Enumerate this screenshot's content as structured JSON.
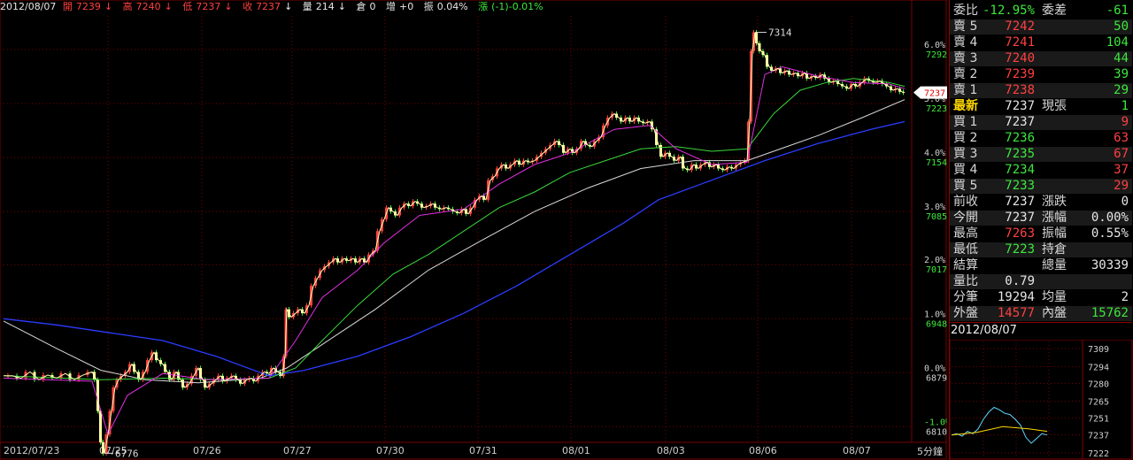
{
  "header": {
    "date": "2012/08/07",
    "open_label": "開",
    "open": "7239",
    "high_label": "高",
    "high": "7240",
    "low_label": "低",
    "low": "7237",
    "close_label": "收",
    "close": "7237",
    "vol_label": "量",
    "vol": "214",
    "oi_label": "倉",
    "oi": "0",
    "chg_label": "增",
    "chg": "+0",
    "amp_label": "振",
    "amp": "0.04%",
    "rise_label": "漲",
    "rise": "(-1)-0.01%",
    "down_arrow": "↓"
  },
  "chart_data": {
    "type": "line",
    "x": [
      "2012/07/23",
      "07/25",
      "07/26",
      "07/27",
      "07/30",
      "07/31",
      "08/01",
      "08/03",
      "08/06",
      "08/07"
    ],
    "interval_label": "5分鐘",
    "ylim": [
      6790,
      7335
    ],
    "ticks_price": [
      "7292",
      "7223",
      "7154",
      "7085",
      "7017",
      "6948",
      "6879",
      "6810"
    ],
    "ticks_pct": [
      "6.0%",
      "5.0%",
      "4.0%",
      "3.0%",
      "2.0%",
      "1.0%",
      "0.0%",
      "-1.0%"
    ],
    "tick_values": [
      7292,
      7223,
      7154,
      7085,
      7017,
      6948,
      6879,
      6810
    ],
    "annot_high": "7314",
    "annot_low": "6776",
    "annot_high_value": 7314,
    "annot_low_value": 6776,
    "last_price": "7237",
    "last_value": 7237,
    "price_path": [
      [
        0,
        6875
      ],
      [
        10,
        6875
      ],
      [
        20,
        6872
      ],
      [
        30,
        6880
      ],
      [
        40,
        6870
      ],
      [
        50,
        6876
      ],
      [
        60,
        6872
      ],
      [
        70,
        6878
      ],
      [
        80,
        6870
      ],
      [
        90,
        6876
      ],
      [
        100,
        6880
      ],
      [
        105,
        6870
      ],
      [
        108,
        6830
      ],
      [
        111,
        6790
      ],
      [
        114,
        6776
      ],
      [
        118,
        6800
      ],
      [
        122,
        6830
      ],
      [
        126,
        6860
      ],
      [
        130,
        6870
      ],
      [
        135,
        6875
      ],
      [
        140,
        6880
      ],
      [
        145,
        6890
      ],
      [
        150,
        6880
      ],
      [
        155,
        6870
      ],
      [
        160,
        6880
      ],
      [
        165,
        6895
      ],
      [
        170,
        6905
      ],
      [
        175,
        6895
      ],
      [
        180,
        6890
      ],
      [
        185,
        6880
      ],
      [
        190,
        6870
      ],
      [
        195,
        6880
      ],
      [
        200,
        6870
      ],
      [
        205,
        6860
      ],
      [
        210,
        6865
      ],
      [
        215,
        6875
      ],
      [
        220,
        6885
      ],
      [
        225,
        6870
      ],
      [
        230,
        6860
      ],
      [
        235,
        6865
      ],
      [
        240,
        6870
      ],
      [
        245,
        6875
      ],
      [
        250,
        6868
      ],
      [
        255,
        6872
      ],
      [
        260,
        6875
      ],
      [
        265,
        6870
      ],
      [
        270,
        6865
      ],
      [
        275,
        6870
      ],
      [
        280,
        6872
      ],
      [
        285,
        6868
      ],
      [
        290,
        6875
      ],
      [
        295,
        6880
      ],
      [
        300,
        6878
      ],
      [
        305,
        6885
      ],
      [
        310,
        6880
      ],
      [
        315,
        6875
      ],
      [
        318,
        6900
      ],
      [
        320,
        6960
      ],
      [
        325,
        6950
      ],
      [
        330,
        6955
      ],
      [
        335,
        6960
      ],
      [
        340,
        6955
      ],
      [
        345,
        6965
      ],
      [
        350,
        6990
      ],
      [
        355,
        7000
      ],
      [
        360,
        7010
      ],
      [
        365,
        7015
      ],
      [
        370,
        7020
      ],
      [
        375,
        7025
      ],
      [
        380,
        7020
      ],
      [
        385,
        7025
      ],
      [
        390,
        7022
      ],
      [
        395,
        7025
      ],
      [
        400,
        7020
      ],
      [
        405,
        7025
      ],
      [
        410,
        7020
      ],
      [
        415,
        7030
      ],
      [
        420,
        7035
      ],
      [
        425,
        7060
      ],
      [
        430,
        7075
      ],
      [
        435,
        7090
      ],
      [
        440,
        7085
      ],
      [
        445,
        7080
      ],
      [
        450,
        7090
      ],
      [
        455,
        7095
      ],
      [
        460,
        7092
      ],
      [
        465,
        7098
      ],
      [
        470,
        7095
      ],
      [
        475,
        7090
      ],
      [
        480,
        7092
      ],
      [
        485,
        7095
      ],
      [
        490,
        7090
      ],
      [
        495,
        7088
      ],
      [
        500,
        7090
      ],
      [
        505,
        7088
      ],
      [
        510,
        7085
      ],
      [
        515,
        7083
      ],
      [
        520,
        7088
      ],
      [
        525,
        7082
      ],
      [
        530,
        7090
      ],
      [
        535,
        7100
      ],
      [
        540,
        7105
      ],
      [
        545,
        7100
      ],
      [
        550,
        7125
      ],
      [
        555,
        7130
      ],
      [
        560,
        7140
      ],
      [
        565,
        7145
      ],
      [
        570,
        7140
      ],
      [
        575,
        7145
      ],
      [
        580,
        7150
      ],
      [
        585,
        7145
      ],
      [
        590,
        7150
      ],
      [
        595,
        7148
      ],
      [
        600,
        7150
      ],
      [
        605,
        7155
      ],
      [
        610,
        7160
      ],
      [
        615,
        7165
      ],
      [
        620,
        7170
      ],
      [
        625,
        7175
      ],
      [
        630,
        7170
      ],
      [
        635,
        7160
      ],
      [
        640,
        7165
      ],
      [
        645,
        7160
      ],
      [
        650,
        7165
      ],
      [
        655,
        7175
      ],
      [
        660,
        7170
      ],
      [
        665,
        7168
      ],
      [
        670,
        7175
      ],
      [
        675,
        7180
      ],
      [
        680,
        7195
      ],
      [
        685,
        7205
      ],
      [
        690,
        7210
      ],
      [
        695,
        7205
      ],
      [
        700,
        7200
      ],
      [
        705,
        7205
      ],
      [
        710,
        7200
      ],
      [
        715,
        7205
      ],
      [
        720,
        7200
      ],
      [
        725,
        7198
      ],
      [
        730,
        7200
      ],
      [
        735,
        7190
      ],
      [
        740,
        7170
      ],
      [
        745,
        7155
      ],
      [
        750,
        7160
      ],
      [
        755,
        7155
      ],
      [
        760,
        7150
      ],
      [
        765,
        7155
      ],
      [
        770,
        7140
      ],
      [
        775,
        7138
      ],
      [
        780,
        7145
      ],
      [
        785,
        7140
      ],
      [
        790,
        7145
      ],
      [
        795,
        7148
      ],
      [
        800,
        7142
      ],
      [
        805,
        7145
      ],
      [
        810,
        7140
      ],
      [
        815,
        7138
      ],
      [
        820,
        7142
      ],
      [
        825,
        7140
      ],
      [
        830,
        7145
      ],
      [
        835,
        7148
      ],
      [
        840,
        7150
      ],
      [
        843,
        7200
      ],
      [
        846,
        7290
      ],
      [
        849,
        7314
      ],
      [
        852,
        7300
      ],
      [
        856,
        7290
      ],
      [
        860,
        7285
      ],
      [
        865,
        7270
      ],
      [
        870,
        7265
      ],
      [
        875,
        7268
      ],
      [
        880,
        7262
      ],
      [
        885,
        7265
      ],
      [
        890,
        7260
      ],
      [
        895,
        7262
      ],
      [
        900,
        7258
      ],
      [
        905,
        7262
      ],
      [
        910,
        7255
      ],
      [
        915,
        7258
      ],
      [
        920,
        7256
      ],
      [
        925,
        7260
      ],
      [
        930,
        7255
      ],
      [
        935,
        7250
      ],
      [
        940,
        7252
      ],
      [
        945,
        7248
      ],
      [
        950,
        7245
      ],
      [
        955,
        7242
      ],
      [
        960,
        7248
      ],
      [
        965,
        7245
      ],
      [
        970,
        7250
      ],
      [
        975,
        7255
      ],
      [
        980,
        7252
      ],
      [
        985,
        7250
      ],
      [
        990,
        7252
      ],
      [
        995,
        7248
      ],
      [
        1000,
        7245
      ],
      [
        1005,
        7240
      ],
      [
        1010,
        7242
      ],
      [
        1015,
        7238
      ],
      [
        1018,
        7237
      ]
    ],
    "ma_white": [
      [
        0,
        6945
      ],
      [
        60,
        6910
      ],
      [
        110,
        6882
      ],
      [
        160,
        6870
      ],
      [
        220,
        6866
      ],
      [
        290,
        6872
      ],
      [
        320,
        6885
      ],
      [
        360,
        6915
      ],
      [
        420,
        6960
      ],
      [
        480,
        7010
      ],
      [
        540,
        7048
      ],
      [
        600,
        7085
      ],
      [
        660,
        7115
      ],
      [
        720,
        7140
      ],
      [
        780,
        7150
      ],
      [
        840,
        7150
      ],
      [
        870,
        7162
      ],
      [
        920,
        7182
      ],
      [
        970,
        7205
      ],
      [
        1018,
        7228
      ]
    ],
    "ma_blue": [
      [
        0,
        6948
      ],
      [
        60,
        6940
      ],
      [
        120,
        6930
      ],
      [
        180,
        6920
      ],
      [
        240,
        6900
      ],
      [
        300,
        6875
      ],
      [
        340,
        6882
      ],
      [
        400,
        6900
      ],
      [
        460,
        6925
      ],
      [
        520,
        6955
      ],
      [
        580,
        6990
      ],
      [
        640,
        7030
      ],
      [
        700,
        7070
      ],
      [
        740,
        7100
      ],
      [
        800,
        7125
      ],
      [
        860,
        7150
      ],
      [
        920,
        7172
      ],
      [
        980,
        7190
      ],
      [
        1018,
        7200
      ]
    ],
    "ma_green": [
      [
        0,
        6875
      ],
      [
        110,
        6870
      ],
      [
        180,
        6872
      ],
      [
        250,
        6870
      ],
      [
        300,
        6872
      ],
      [
        330,
        6885
      ],
      [
        360,
        6920
      ],
      [
        400,
        6965
      ],
      [
        440,
        7005
      ],
      [
        480,
        7030
      ],
      [
        520,
        7060
      ],
      [
        560,
        7090
      ],
      [
        600,
        7110
      ],
      [
        640,
        7135
      ],
      [
        680,
        7150
      ],
      [
        720,
        7165
      ],
      [
        760,
        7168
      ],
      [
        800,
        7162
      ],
      [
        840,
        7165
      ],
      [
        870,
        7210
      ],
      [
        900,
        7240
      ],
      [
        930,
        7250
      ],
      [
        960,
        7255
      ],
      [
        1000,
        7250
      ],
      [
        1018,
        7245
      ]
    ],
    "ma_magenta": [
      [
        0,
        6872
      ],
      [
        100,
        6868
      ],
      [
        118,
        6800
      ],
      [
        140,
        6850
      ],
      [
        180,
        6878
      ],
      [
        230,
        6870
      ],
      [
        300,
        6872
      ],
      [
        330,
        6920
      ],
      [
        360,
        6975
      ],
      [
        400,
        7010
      ],
      [
        430,
        7045
      ],
      [
        470,
        7080
      ],
      [
        520,
        7088
      ],
      [
        560,
        7120
      ],
      [
        600,
        7145
      ],
      [
        640,
        7160
      ],
      [
        690,
        7190
      ],
      [
        730,
        7195
      ],
      [
        760,
        7165
      ],
      [
        800,
        7145
      ],
      [
        840,
        7148
      ],
      [
        860,
        7260
      ],
      [
        880,
        7270
      ],
      [
        920,
        7258
      ],
      [
        960,
        7250
      ],
      [
        1000,
        7248
      ],
      [
        1018,
        7242
      ]
    ]
  },
  "panel": {
    "rows": [
      {
        "l1": "委比",
        "v1": "-12.95%",
        "c1": "green",
        "l2": "委差",
        "v2": "-61",
        "c2": "green"
      },
      {
        "l1": "賣 5",
        "v1": "7242",
        "c1": "red",
        "v2": "50",
        "c2": "green"
      },
      {
        "l1": "賣 4",
        "v1": "7241",
        "c1": "red",
        "v2": "104",
        "c2": "green"
      },
      {
        "l1": "賣 3",
        "v1": "7240",
        "c1": "red",
        "v2": "44",
        "c2": "green"
      },
      {
        "l1": "賣 2",
        "v1": "7239",
        "c1": "red",
        "v2": "39",
        "c2": "green"
      },
      {
        "l1": "賣 1",
        "v1": "7238",
        "c1": "red",
        "v2": "29",
        "c2": "green"
      },
      {
        "l1": "最新",
        "v1": "7237",
        "c1": "white",
        "l2": "現張",
        "v2": "1",
        "c2": "green",
        "hl": true
      },
      {
        "l1": "買 1",
        "v1": "7237",
        "c1": "white",
        "v2": "9",
        "c2": "red"
      },
      {
        "l1": "買 2",
        "v1": "7236",
        "c1": "green",
        "v2": "63",
        "c2": "red"
      },
      {
        "l1": "買 3",
        "v1": "7235",
        "c1": "green",
        "v2": "67",
        "c2": "red"
      },
      {
        "l1": "買 4",
        "v1": "7234",
        "c1": "green",
        "v2": "37",
        "c2": "red"
      },
      {
        "l1": "買 5",
        "v1": "7233",
        "c1": "green",
        "v2": "29",
        "c2": "red"
      },
      {
        "l1": "前收",
        "v1": "7237",
        "c1": "white",
        "l2": "漲跌",
        "v2": "0",
        "c2": "white"
      },
      {
        "l1": "今開",
        "v1": "7237",
        "c1": "white",
        "l2": "漲幅",
        "v2": "0.00%",
        "c2": "white"
      },
      {
        "l1": "最高",
        "v1": "7263",
        "c1": "red",
        "l2": "振幅",
        "v2": "0.55%",
        "c2": "white"
      },
      {
        "l1": "最低",
        "v1": "7223",
        "c1": "green",
        "l2": "持倉",
        "v2": "",
        "c2": "white"
      },
      {
        "l1": "結算",
        "v1": "",
        "c1": "white",
        "l2": "總量",
        "v2": "30339",
        "c2": "white"
      },
      {
        "l1": "量比",
        "v1": "0.79",
        "c1": "white",
        "v2": "",
        "c2": "white"
      },
      {
        "l1": "分筆",
        "v1": "19294",
        "c1": "white",
        "l2": "均量",
        "v2": "2",
        "c2": "white"
      },
      {
        "l1": "外盤",
        "v1": "14577",
        "c1": "red",
        "l2": "內盤",
        "v2": "15762",
        "c2": "green"
      }
    ],
    "mini_date": "2012/08/07",
    "mini_ticks": [
      "7309",
      "7294",
      "7280",
      "7265",
      "7251",
      "7237",
      "7222"
    ],
    "mini_tick_values": [
      7309,
      7294,
      7280,
      7265,
      7251,
      7237,
      7222
    ]
  },
  "colors": {
    "up": "#ff4040",
    "down": "#3ce83c",
    "grid": "#7a0000",
    "ma_white": "#d8d8d8",
    "ma_blue": "#2b3cff",
    "ma_green": "#3ad83a",
    "ma_magenta": "#e030e0",
    "candle": "#ffffa0"
  }
}
